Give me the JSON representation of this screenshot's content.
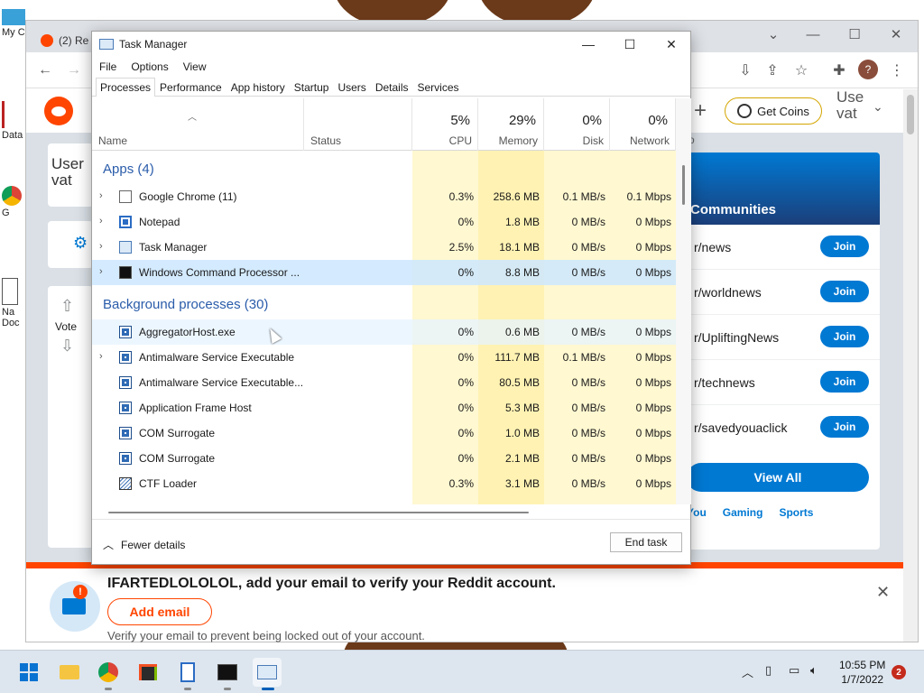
{
  "desktop": {
    "icons": [
      {
        "label": "My C",
        "icon": "computer-icon"
      },
      {
        "label": "Data",
        "icon": "shortcut-icon"
      },
      {
        "label": "G",
        "icon": "chrome-icon"
      },
      {
        "label": "Na Doc",
        "icon": "document-icon"
      }
    ]
  },
  "chrome": {
    "tab_title": "(2) Re",
    "window_controls": [
      "chevron-down-icon",
      "minimize-icon",
      "maximize-icon",
      "close-icon"
    ],
    "avatar_letter": "?",
    "reddit": {
      "coins_label": "Get Coins",
      "user_partial": "Use vat",
      "left_avatar_text": "User vat",
      "vote_label": "Vote",
      "communities_title": "Communities",
      "communities": [
        {
          "name": "r/news",
          "join": "Join"
        },
        {
          "name": "r/worldnews",
          "join": "Join"
        },
        {
          "name": "r/UpliftingNews",
          "join": "Join"
        },
        {
          "name": "r/technews",
          "join": "Join"
        },
        {
          "name": "r/savedyouaclick",
          "join": "Join"
        }
      ],
      "view_all": "View All",
      "category_tabs": [
        "You",
        "Gaming",
        "Sports"
      ],
      "email_banner": {
        "title": "IFARTEDLOLOLOL, add your email to verify your Reddit account.",
        "button": "Add email",
        "subtitle": "Verify your email to prevent being locked out of your account.",
        "badge": "!"
      },
      "brand_color": "#ff4500",
      "accent_color": "#0079d3"
    }
  },
  "task_manager": {
    "title": "Task Manager",
    "menu": [
      "File",
      "Options",
      "View"
    ],
    "tabs": [
      "Processes",
      "Performance",
      "App history",
      "Startup",
      "Users",
      "Details",
      "Services"
    ],
    "active_tab": "Processes",
    "columns": {
      "name": "Name",
      "status": "Status",
      "cpu": {
        "label": "CPU",
        "pct": "5%"
      },
      "memory": {
        "label": "Memory",
        "pct": "29%"
      },
      "disk": {
        "label": "Disk",
        "pct": "0%"
      },
      "network": {
        "label": "Network",
        "pct": "0%"
      },
      "power_partial": "Po"
    },
    "apps_group": "Apps (4)",
    "apps": [
      {
        "name": "Google Chrome (11)",
        "icon": "chrome-window-icon",
        "expand": true,
        "cpu": "0.3%",
        "memory": "258.6 MB",
        "disk": "0.1 MB/s",
        "network": "0.1 Mbps"
      },
      {
        "name": "Notepad",
        "icon": "notepad-icon",
        "expand": true,
        "cpu": "0%",
        "memory": "1.8 MB",
        "disk": "0 MB/s",
        "network": "0 Mbps"
      },
      {
        "name": "Task Manager",
        "icon": "task-manager-icon",
        "expand": true,
        "cpu": "2.5%",
        "memory": "18.1 MB",
        "disk": "0 MB/s",
        "network": "0 Mbps"
      },
      {
        "name": "Windows Command Processor ...",
        "icon": "cmd-icon",
        "expand": true,
        "cpu": "0%",
        "memory": "8.8 MB",
        "disk": "0 MB/s",
        "network": "0 Mbps"
      }
    ],
    "bg_group": "Background processes (30)",
    "background": [
      {
        "name": "AggregatorHost.exe",
        "icon": "app-window-icon",
        "expand": false,
        "cpu": "0%",
        "memory": "0.6 MB",
        "disk": "0 MB/s",
        "network": "0 Mbps"
      },
      {
        "name": "Antimalware Service Executable",
        "icon": "app-window-icon",
        "expand": true,
        "cpu": "0%",
        "memory": "111.7 MB",
        "disk": "0.1 MB/s",
        "network": "0 Mbps"
      },
      {
        "name": "Antimalware Service Executable...",
        "icon": "app-window-icon",
        "expand": false,
        "cpu": "0%",
        "memory": "80.5 MB",
        "disk": "0 MB/s",
        "network": "0 Mbps"
      },
      {
        "name": "Application Frame Host",
        "icon": "app-window-icon",
        "expand": false,
        "cpu": "0%",
        "memory": "5.3 MB",
        "disk": "0 MB/s",
        "network": "0 Mbps"
      },
      {
        "name": "COM Surrogate",
        "icon": "app-window-icon",
        "expand": false,
        "cpu": "0%",
        "memory": "1.0 MB",
        "disk": "0 MB/s",
        "network": "0 Mbps"
      },
      {
        "name": "COM Surrogate",
        "icon": "app-window-icon",
        "expand": false,
        "cpu": "0%",
        "memory": "2.1 MB",
        "disk": "0 MB/s",
        "network": "0 Mbps"
      },
      {
        "name": "CTF Loader",
        "icon": "ctf-loader-icon",
        "expand": false,
        "cpu": "0.3%",
        "memory": "3.1 MB",
        "disk": "0 MB/s",
        "network": "0 Mbps"
      }
    ],
    "fewer_details": "Fewer details",
    "end_task": "End task"
  },
  "taskbar": {
    "apps": [
      "start-icon",
      "file-explorer-icon",
      "chrome-icon",
      "store-icon",
      "notepad-icon",
      "terminal-icon",
      "task-manager-icon"
    ],
    "tray_icons": [
      "chevron-up-icon",
      "battery-icon",
      "network-icon",
      "volume-icon"
    ],
    "time": "10:55 PM",
    "date": "1/7/2022",
    "notification_count": "2"
  }
}
